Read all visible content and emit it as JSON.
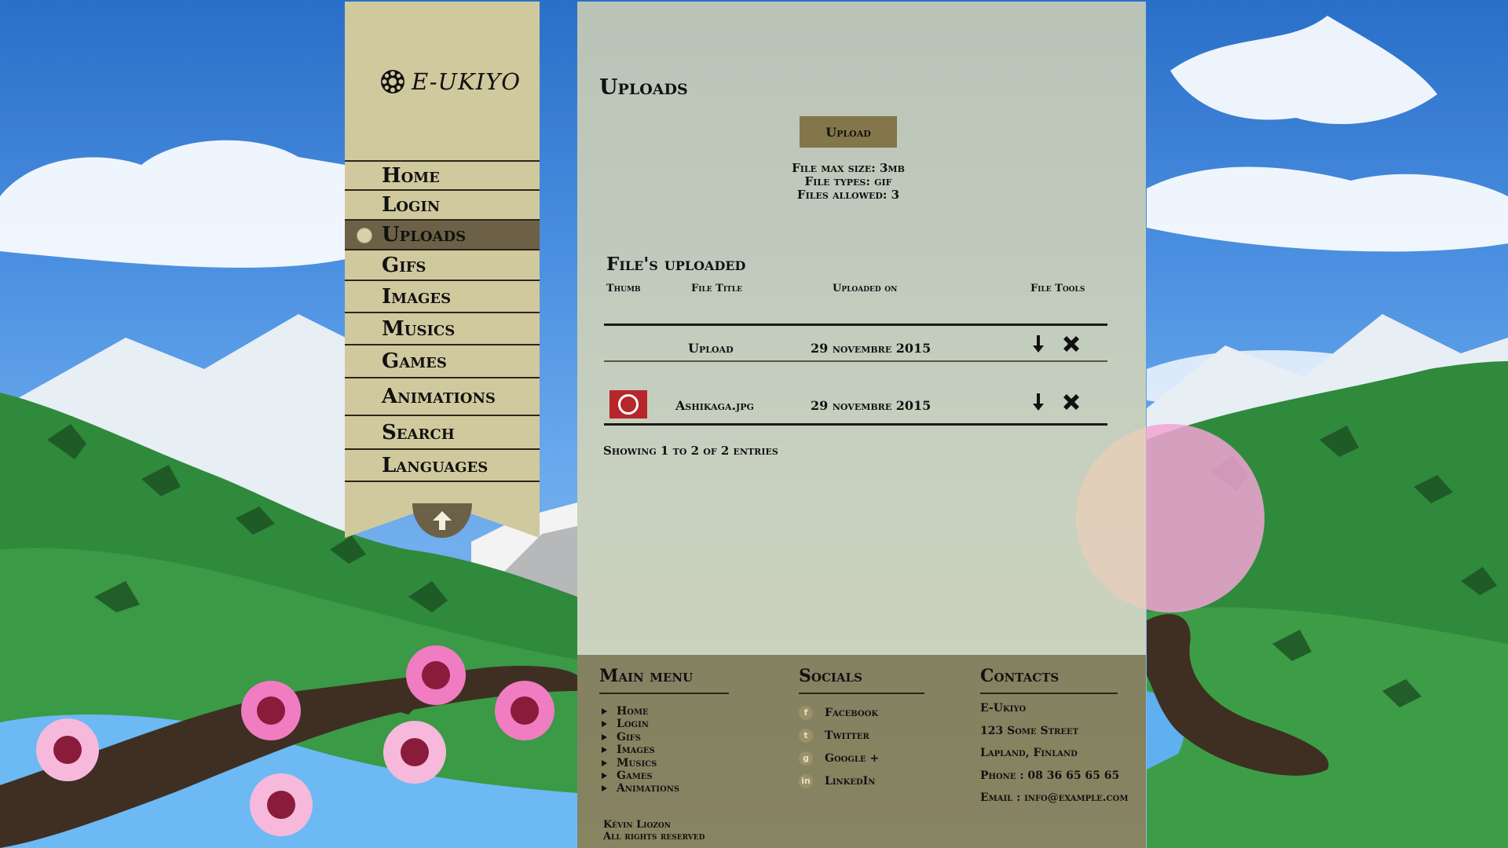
{
  "app": {
    "logo_text": "E-UKIYO"
  },
  "sidebar": {
    "items": [
      {
        "label": "Home"
      },
      {
        "label": "Login"
      },
      {
        "label": "Uploads",
        "active": true
      },
      {
        "label": "Gifs"
      },
      {
        "label": "Images"
      },
      {
        "label": "Musics"
      },
      {
        "label": "Games"
      },
      {
        "label": "Animations"
      },
      {
        "label": "Search"
      },
      {
        "label": "Languages"
      }
    ]
  },
  "main": {
    "title": "Uploads",
    "upload_button": "Upload",
    "file_info": {
      "max_size": "File max size: 3mb",
      "types": "File types: gif",
      "allowed": "Files allowed: 3"
    },
    "table": {
      "title": "File's uploaded",
      "columns": [
        "Thumb",
        "File Title",
        "Uploaded on",
        "File Tools"
      ],
      "rows": [
        {
          "thumb": null,
          "title": "Upload",
          "date": "29 novembre 2015"
        },
        {
          "thumb": "red-circle",
          "title": "Ashikaga.jpg",
          "date": "29 novembre 2015"
        }
      ],
      "showing": "Showing 1 to 2 of 2 entries"
    }
  },
  "footer": {
    "main_menu": {
      "title": "Main menu",
      "items": [
        "Home",
        "Login",
        "Gifs",
        "Images",
        "Musics",
        "Games",
        "Animations"
      ]
    },
    "socials": {
      "title": "Socials",
      "items": [
        {
          "label": "Facebook",
          "icon": "facebook-icon",
          "glyph": "f"
        },
        {
          "label": "Twitter",
          "icon": "twitter-icon",
          "glyph": "t"
        },
        {
          "label": "Google +",
          "icon": "google-plus-icon",
          "glyph": "g"
        },
        {
          "label": "LinkedIn",
          "icon": "linkedin-icon",
          "glyph": "in"
        }
      ]
    },
    "contacts": {
      "title": "Contacts",
      "lines": [
        "E-Ukiyo",
        "123 Some Street",
        "Lapland, Finland",
        "Phone : 08 36 65 65 65",
        "Email : info@example.com"
      ]
    },
    "copyright": {
      "author": "Kévin Liozon",
      "rights": "All rights reserved"
    }
  },
  "colors": {
    "sky": "#4a8fe0",
    "panel": "#e2dbb2",
    "sidebar": "#d1c99e",
    "active": "#6c6146",
    "button": "#83764a",
    "footer": "#867642",
    "thumb_red": "#b6262b"
  }
}
